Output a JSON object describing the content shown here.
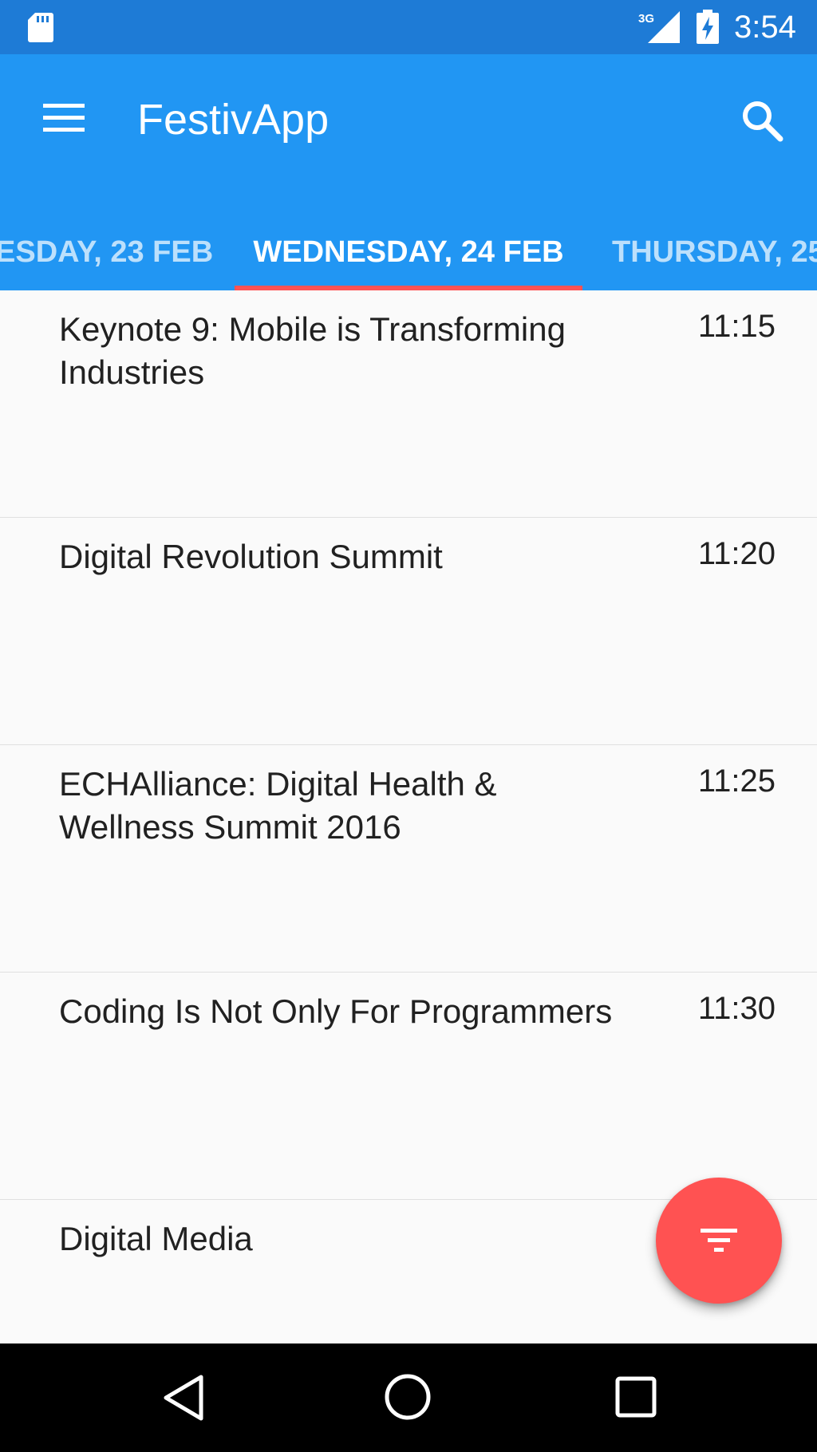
{
  "status_bar": {
    "time": "3:54",
    "network": "3G",
    "icons": [
      "sd-card-icon",
      "signal-3g-icon",
      "battery-charging-icon"
    ]
  },
  "app_bar": {
    "title": "FestivApp",
    "menu_icon": "menu-icon",
    "search_icon": "search-icon",
    "color": "#2196f3"
  },
  "tabs": {
    "prev_label": "ESDAY, 23 FEB",
    "current_label": "WEDNESDAY, 24 FEB",
    "next_label": "THURSDAY, 25",
    "indicator_color": "#ff5252"
  },
  "sessions": [
    {
      "title": "Keynote 9: Mobile is Transforming Industries",
      "time": "11:15"
    },
    {
      "title": "Digital Revolution Summit",
      "time": "11:20"
    },
    {
      "title": "ECHAlliance: Digital Health & Wellness Summit 2016",
      "time": "11:25"
    },
    {
      "title": "Coding Is Not Only For Programmers",
      "time": "11:30"
    },
    {
      "title": "Digital Media",
      "time": ""
    }
  ],
  "fab": {
    "icon": "filter-icon",
    "color": "#ff5252"
  },
  "nav_bar": {
    "icons": [
      "back-icon",
      "home-icon",
      "recents-icon"
    ]
  }
}
